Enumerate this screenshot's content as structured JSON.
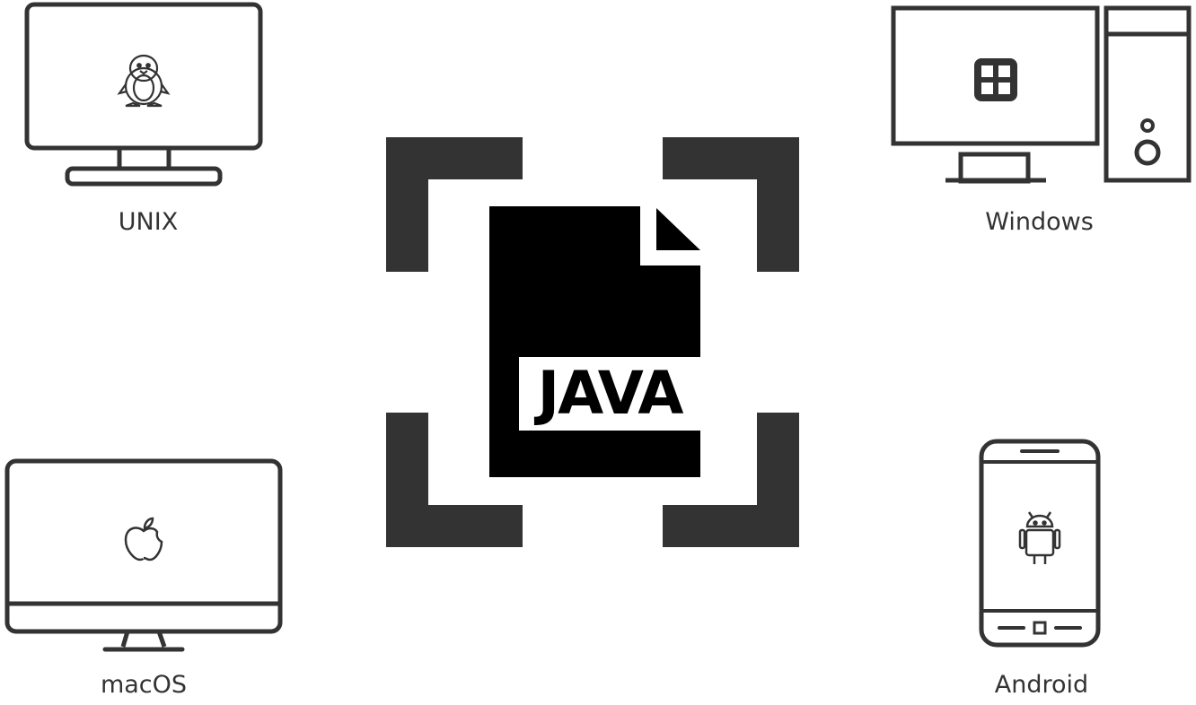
{
  "platforms": {
    "unix": {
      "label": "UNIX",
      "icon": "penguin-icon"
    },
    "windows": {
      "label": "Windows",
      "icon": "windows-logo-icon"
    },
    "macos": {
      "label": "macOS",
      "icon": "apple-logo-icon"
    },
    "android": {
      "label": "Android",
      "icon": "android-robot-icon"
    }
  },
  "center": {
    "file_label": "JAVA",
    "icon": "java-file-icon"
  },
  "colors": {
    "stroke": "#333333",
    "file": "#000000",
    "bracket": "#333333",
    "background": "#ffffff"
  }
}
